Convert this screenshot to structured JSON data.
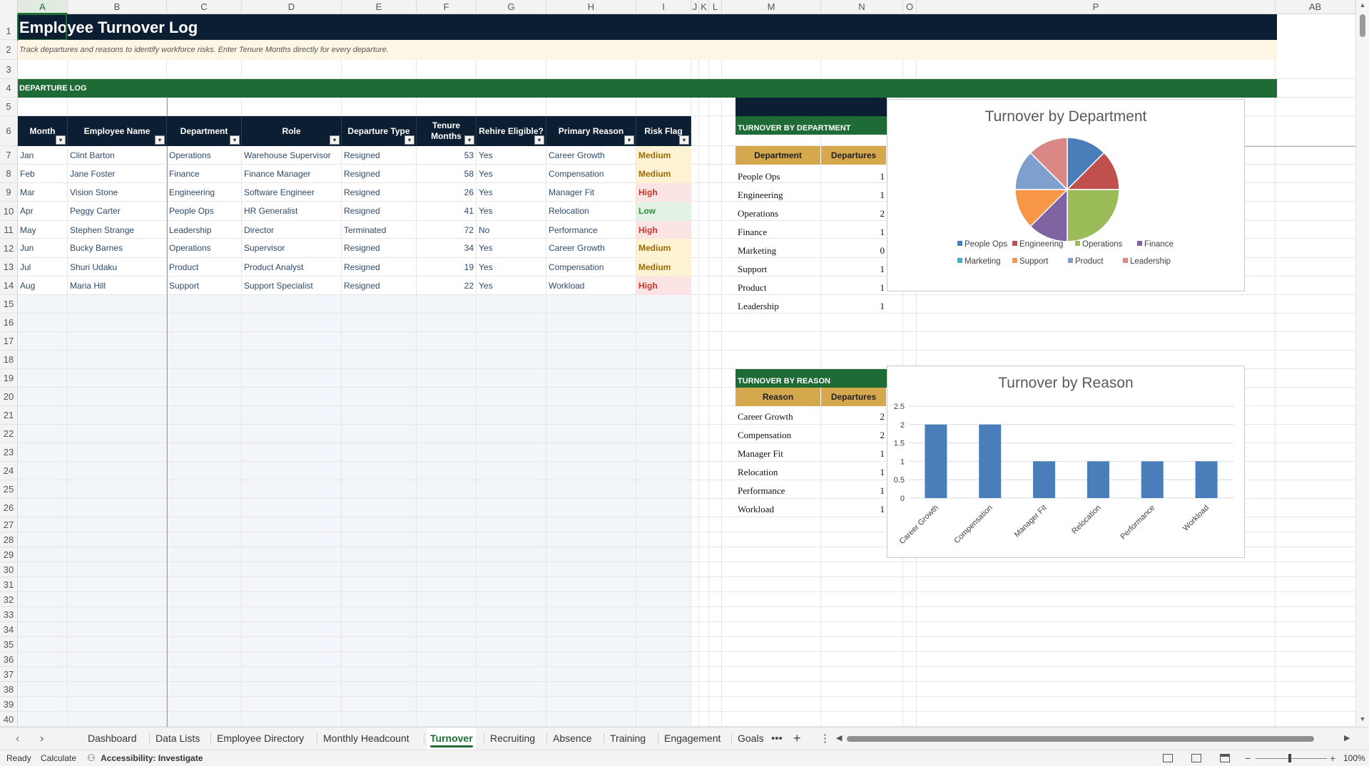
{
  "columns": [
    "A",
    "B",
    "C",
    "D",
    "E",
    "F",
    "G",
    "H",
    "I",
    "J",
    "K",
    "L",
    "M",
    "N",
    "O",
    "P",
    "AB"
  ],
  "rows": [
    "1",
    "2",
    "3",
    "4",
    "5",
    "6",
    "7",
    "8",
    "9",
    "10",
    "11",
    "12",
    "13",
    "14",
    "15",
    "16",
    "17",
    "18",
    "19",
    "20",
    "21",
    "22",
    "23",
    "24",
    "25",
    "26",
    "27",
    "28",
    "29",
    "30",
    "31",
    "32",
    "33",
    "34",
    "35",
    "36",
    "37",
    "38",
    "39",
    "40"
  ],
  "title": "Employee Turnover Log",
  "subtitle": "Track departures and reasons to identify workforce risks. Enter Tenure Months directly for every departure.",
  "section_label": "DEPARTURE LOG",
  "filter_glyph": "▾",
  "log": {
    "headers": [
      "Month",
      "Employee Name",
      "Department",
      "Role",
      "Departure Type",
      "Tenure Months",
      "Rehire Eligible?",
      "Primary Reason",
      "Risk Flag"
    ],
    "rows": [
      [
        "Jan",
        "Clint Barton",
        "Operations",
        "Warehouse Supervisor",
        "Resigned",
        "53",
        "Yes",
        "Career Growth",
        "Medium"
      ],
      [
        "Feb",
        "Jane Foster",
        "Finance",
        "Finance Manager",
        "Resigned",
        "58",
        "Yes",
        "Compensation",
        "Medium"
      ],
      [
        "Mar",
        "Vision Stone",
        "Engineering",
        "Software Engineer",
        "Resigned",
        "26",
        "Yes",
        "Manager Fit",
        "High"
      ],
      [
        "Apr",
        "Peggy Carter",
        "People Ops",
        "HR Generalist",
        "Resigned",
        "41",
        "Yes",
        "Relocation",
        "Low"
      ],
      [
        "May",
        "Stephen Strange",
        "Leadership",
        "Director",
        "Terminated",
        "72",
        "No",
        "Performance",
        "High"
      ],
      [
        "Jun",
        "Bucky Barnes",
        "Operations",
        "Supervisor",
        "Resigned",
        "34",
        "Yes",
        "Career Growth",
        "Medium"
      ],
      [
        "Jul",
        "Shuri Udaku",
        "Product",
        "Product Analyst",
        "Resigned",
        "19",
        "Yes",
        "Compensation",
        "Medium"
      ],
      [
        "Aug",
        "Maria Hill",
        "Support",
        "Support Specialist",
        "Resigned",
        "22",
        "Yes",
        "Workload",
        "High"
      ]
    ]
  },
  "risk_colors": {
    "Medium": {
      "bg": "#fdf3d4",
      "fg": "#9a6a00"
    },
    "High": {
      "bg": "#fde4e4",
      "fg": "#c0392b"
    },
    "Low": {
      "bg": "#e3f3e3",
      "fg": "#2e8b3d"
    }
  },
  "by_department": {
    "label": "TURNOVER BY DEPARTMENT",
    "headers": [
      "Department",
      "Departures"
    ],
    "rows": [
      [
        "People Ops",
        "1"
      ],
      [
        "Engineering",
        "1"
      ],
      [
        "Operations",
        "2"
      ],
      [
        "Finance",
        "1"
      ],
      [
        "Marketing",
        "0"
      ],
      [
        "Support",
        "1"
      ],
      [
        "Product",
        "1"
      ],
      [
        "Leadership",
        "1"
      ]
    ]
  },
  "by_reason": {
    "label": "TURNOVER BY REASON",
    "headers": [
      "Reason",
      "Departures"
    ],
    "rows": [
      [
        "Career Growth",
        "2"
      ],
      [
        "Compensation",
        "2"
      ],
      [
        "Manager Fit",
        "1"
      ],
      [
        "Relocation",
        "1"
      ],
      [
        "Performance",
        "1"
      ],
      [
        "Workload",
        "1"
      ]
    ]
  },
  "chart_data": [
    {
      "type": "pie",
      "title": "Turnover by Department",
      "categories": [
        "People Ops",
        "Engineering",
        "Operations",
        "Finance",
        "Marketing",
        "Support",
        "Product",
        "Leadership"
      ],
      "values": [
        1,
        1,
        2,
        1,
        0,
        1,
        1,
        1
      ],
      "colors": [
        "#4a7ebb",
        "#c0504d",
        "#9bbb59",
        "#8064a2",
        "#4bacc6",
        "#f79646",
        "#7f9fcf",
        "#d98886"
      ],
      "legend": "bottom"
    },
    {
      "type": "bar",
      "title": "Turnover by Reason",
      "categories": [
        "Career Growth",
        "Compensation",
        "Manager Fit",
        "Relocation",
        "Performance",
        "Workload"
      ],
      "values": [
        2,
        2,
        1,
        1,
        1,
        1
      ],
      "ylim": [
        0,
        2.5
      ],
      "yticks": [
        "0",
        "0.5",
        "1",
        "1.5",
        "2",
        "2.5"
      ],
      "color": "#4a7ebb",
      "grid": true
    }
  ],
  "sheet_tabs": [
    "Dashboard",
    "Data Lists",
    "Employee Directory",
    "Monthly Headcount",
    "Turnover",
    "Recruiting",
    "Absence",
    "Training",
    "Engagement",
    "Goals"
  ],
  "active_tab": "Turnover",
  "status": {
    "ready": "Ready",
    "calculate": "Calculate",
    "accessibility": "Accessibility: Investigate",
    "zoom": "100%"
  }
}
